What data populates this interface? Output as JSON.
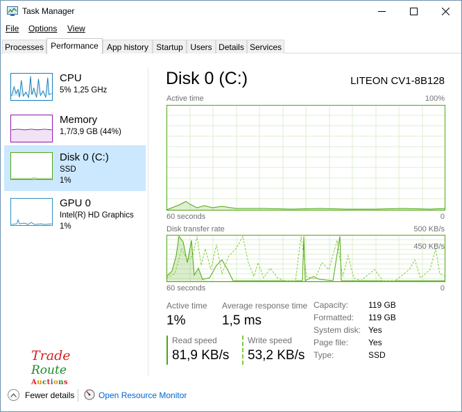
{
  "window": {
    "title": "Task Manager",
    "icon": "task-manager-icon",
    "controls": [
      "minimize-icon",
      "maximize-icon",
      "close-icon"
    ]
  },
  "menu": {
    "file": "File",
    "options": "Options",
    "view": "View"
  },
  "tabs": [
    {
      "label": "Processes"
    },
    {
      "label": "Performance",
      "active": true
    },
    {
      "label": "App history"
    },
    {
      "label": "Startup"
    },
    {
      "label": "Users"
    },
    {
      "label": "Details"
    },
    {
      "label": "Services"
    }
  ],
  "sidebar": {
    "cpu": {
      "name": "CPU",
      "detail": "5% 1,25 GHz"
    },
    "memory": {
      "name": "Memory",
      "detail": "1,7/3,9 GB (44%)"
    },
    "disk": {
      "name": "Disk 0 (C:)",
      "type": "SSD",
      "usage": "1%"
    },
    "gpu": {
      "name": "GPU 0",
      "detail": "Intel(R) HD Graphics",
      "usage": "1%"
    }
  },
  "main": {
    "title": "Disk 0 (C:)",
    "device": "LITEON CV1-8B128",
    "active_time_graph": {
      "label": "Active time",
      "max": "100%",
      "duration": "60 seconds",
      "min": "0"
    },
    "transfer_graph": {
      "label": "Disk transfer rate",
      "max": "500 KB/s",
      "mid": "450 KB/s",
      "duration": "60 seconds",
      "min": "0"
    },
    "stats": {
      "active_time_label": "Active time",
      "active_time": "1%",
      "avg_response_label": "Average response time",
      "avg_response": "1,5 ms",
      "read_label": "Read speed",
      "read": "81,9 KB/s",
      "write_label": "Write speed",
      "write": "53,2 KB/s"
    },
    "properties": [
      {
        "label": "Capacity:",
        "value": "119 GB"
      },
      {
        "label": "Formatted:",
        "value": "119 GB"
      },
      {
        "label": "System disk:",
        "value": "Yes"
      },
      {
        "label": "Page file:",
        "value": "Yes"
      },
      {
        "label": "Type:",
        "value": "SSD"
      }
    ]
  },
  "footer": {
    "fewer_details": "Fewer details",
    "open_monitor": "Open Resource Monitor"
  },
  "watermark": {
    "line1": "Trade",
    "line2": "Route",
    "line3": "Auctions"
  },
  "colors": {
    "disk": "#4da60c",
    "cpu": "#117dbb",
    "memory": "#8b12ae",
    "gpu": "#2d8fbd",
    "selected": "#cce8ff",
    "link": "#0066cc"
  }
}
